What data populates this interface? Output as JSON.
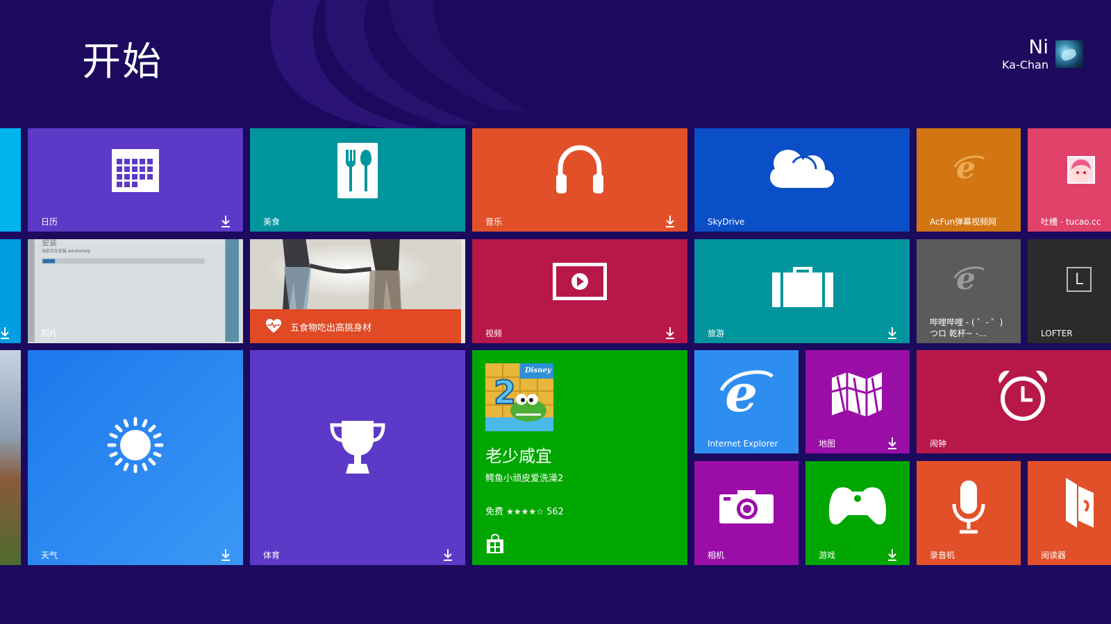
{
  "header": {
    "title": "开始",
    "user_first": "Ni",
    "user_last": "Ka-Chan"
  },
  "colors": {
    "background": "#1b0a5e",
    "purple": "#5d39c7",
    "teal": "#00959c",
    "orange": "#e2502a",
    "blue": "#0a4fc7",
    "crimson": "#b8174a",
    "green": "#00a700",
    "magenta": "#9a0ea7",
    "sky": "#2e8ef0"
  },
  "tiles": {
    "calendar": {
      "label": "日历",
      "icon": "calendar-icon"
    },
    "food": {
      "label": "美食",
      "icon": "fork-spoon-icon"
    },
    "music": {
      "label": "音乐",
      "icon": "headphones-icon"
    },
    "skydrive": {
      "label": "SkyDrive",
      "icon": "cloud-icon"
    },
    "acfun": {
      "label": "AcFun弹幕视频网",
      "icon": "ie-icon"
    },
    "tucao": {
      "label": "吐槽 - tucao.cc",
      "icon": "avatar-icon"
    },
    "photos": {
      "label": "照片",
      "screen_text_1": "安装",
      "screen_text_2": "当前正在安装 AdobeHelp"
    },
    "health": {
      "band_text": "五食物吃出高挑身材",
      "icon": "heart-pulse-icon"
    },
    "video": {
      "label": "视频",
      "icon": "play-icon"
    },
    "travel": {
      "label": "旅游",
      "icon": "suitcase-icon"
    },
    "bilibili": {
      "label_line1": "哔哩哔哩 - ( ゜- ゜)",
      "label_line2": "つロ 乾杯~ -...",
      "icon": "ie-icon"
    },
    "lofter": {
      "label": "LOFTER",
      "glyph": "L"
    },
    "weather": {
      "label": "天气",
      "icon": "sun-icon"
    },
    "sports": {
      "label": "体育",
      "icon": "trophy-icon"
    },
    "store_promo": {
      "title": "老少咸宜",
      "subtitle": "鳄鱼小顽皮爱洗澡2",
      "price": "免费",
      "stars": "★★★★☆",
      "count": "562",
      "badge": "Disney",
      "art_number": "2"
    },
    "ie": {
      "label": "Internet Explorer",
      "icon": "ie-icon"
    },
    "maps": {
      "label": "地图",
      "icon": "map-icon"
    },
    "alarms": {
      "label": "闹钟",
      "icon": "alarm-clock-icon"
    },
    "camera": {
      "label": "相机",
      "icon": "camera-icon"
    },
    "games": {
      "label": "游戏",
      "icon": "gamepad-icon"
    },
    "recorder": {
      "label": "录音机",
      "icon": "microphone-icon"
    },
    "reader": {
      "label": "阅读器",
      "icon": "reader-icon"
    }
  }
}
